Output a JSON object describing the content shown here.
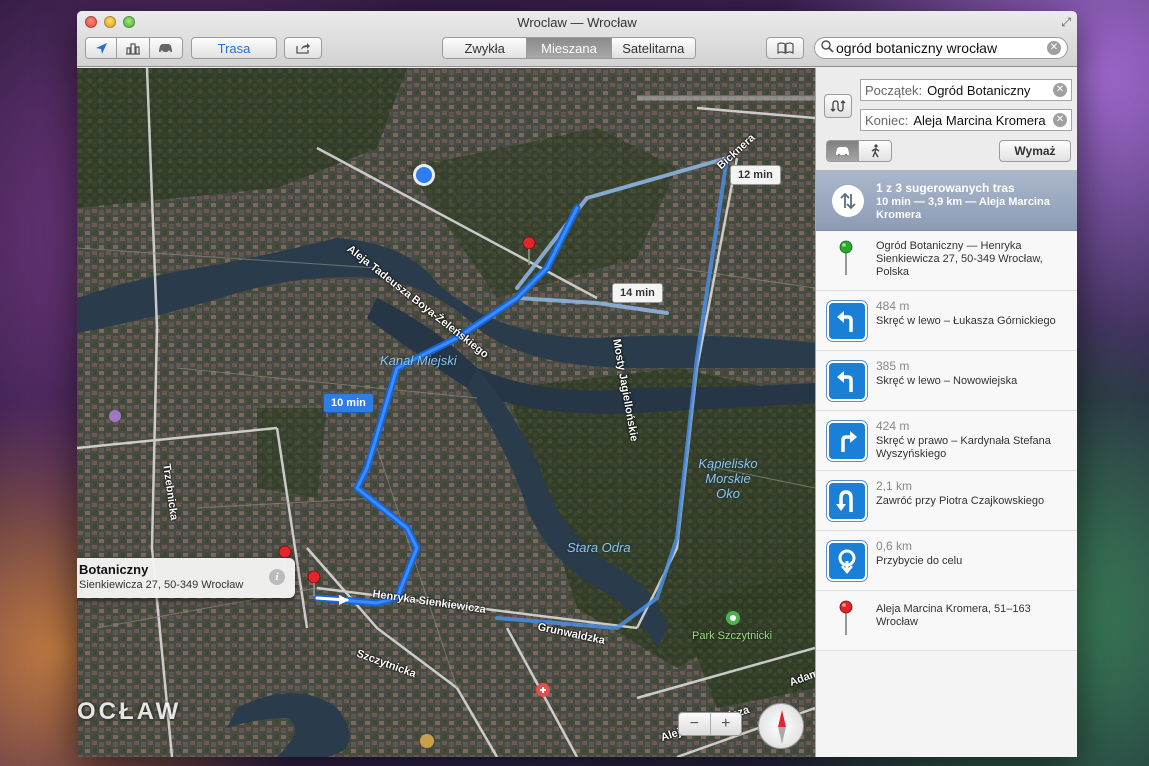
{
  "window": {
    "title": "Wroclaw — Wrocław"
  },
  "toolbar": {
    "route_label": "Trasa",
    "view_modes": [
      {
        "label": "Zwykła",
        "active": false
      },
      {
        "label": "Mieszana",
        "active": true
      },
      {
        "label": "Satelitarna",
        "active": false
      }
    ],
    "search_value": "ogród botaniczny wrocław"
  },
  "map": {
    "street_labels": [
      "Aleja Tadeusza Boya-Żeleńskiego",
      "Henryka Sienkiewicza",
      "Grunwaldzka",
      "Mosty Jagiellońskie",
      "Trzebnicka",
      "Szczytnicka",
      "Aleja Mickiewicza",
      "Bicknera",
      "Adam"
    ],
    "water_labels": [
      "Kanał Miejski",
      "Kąpielisko Morskie Oko",
      "Stara Odra"
    ],
    "park_label": "Park Szczytnicki",
    "city_label": "OCŁAW",
    "time_bubbles": [
      "10 min",
      "14 min",
      "12 min"
    ],
    "callout": {
      "title": "Botaniczny",
      "subtitle": "Sienkiewicza 27, 50-349 Wrocław"
    },
    "zoom_out": "−",
    "zoom_in": "+"
  },
  "directions": {
    "start_label": "Początek:",
    "start_value": "Ogród Botaniczny",
    "end_label": "Koniec:",
    "end_value": "Aleja Marcina Kromera",
    "clear_label": "Wymaż",
    "summary_title": "1 z 3 sugerowanych tras",
    "summary_sub": "10 min — 3,9 km — Aleja Marcina Kromera",
    "start_point": "Ogród Botaniczny — Henryka Sienkiewicza 27, 50-349 Wrocław, Polska",
    "steps": [
      {
        "dist": "484 m",
        "desc": "Skręć w lewo – Łukasza Górnickiego",
        "icon": "turn-left"
      },
      {
        "dist": "385 m",
        "desc": "Skręć w lewo – Nowowiejska",
        "icon": "turn-left"
      },
      {
        "dist": "424 m",
        "desc": "Skręć w prawo – Kardynała Stefana Wyszyńskiego",
        "icon": "turn-right"
      },
      {
        "dist": "2,1 km",
        "desc": "Zawróć przy Piotra Czajkowskiego",
        "icon": "u-turn"
      },
      {
        "dist": "0,6 km",
        "desc": "Przybycie do celu",
        "icon": "arrive"
      }
    ],
    "end_point": "Aleja Marcina Kromera, 51–163 Wrocław"
  }
}
